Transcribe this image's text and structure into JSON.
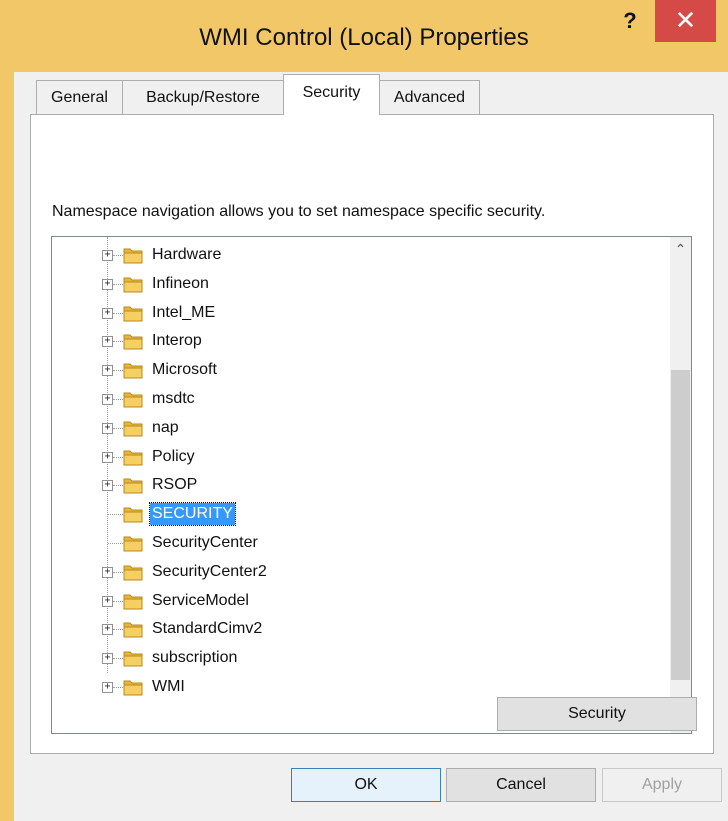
{
  "window": {
    "title": "WMI Control (Local) Properties",
    "help_label": "?",
    "close_label": "✕"
  },
  "tabs": [
    {
      "label": "General"
    },
    {
      "label": "Backup/Restore"
    },
    {
      "label": "Security",
      "active": true
    },
    {
      "label": "Advanced"
    }
  ],
  "security_tab": {
    "description": "Namespace navigation allows you to set namespace specific security.",
    "tree_items": [
      {
        "label": "Hardware",
        "expandable": true
      },
      {
        "label": "Infineon",
        "expandable": true
      },
      {
        "label": "Intel_ME",
        "expandable": true
      },
      {
        "label": "Interop",
        "expandable": true
      },
      {
        "label": "Microsoft",
        "expandable": true
      },
      {
        "label": "msdtc",
        "expandable": true
      },
      {
        "label": "nap",
        "expandable": true
      },
      {
        "label": "Policy",
        "expandable": true
      },
      {
        "label": "RSOP",
        "expandable": true
      },
      {
        "label": "SECURITY",
        "expandable": false,
        "selected": true
      },
      {
        "label": "SecurityCenter",
        "expandable": false
      },
      {
        "label": "SecurityCenter2",
        "expandable": true
      },
      {
        "label": "ServiceModel",
        "expandable": true
      },
      {
        "label": "StandardCimv2",
        "expandable": true
      },
      {
        "label": "subscription",
        "expandable": true
      },
      {
        "label": "WMI",
        "expandable": true
      }
    ],
    "security_button": "Security"
  },
  "footer": {
    "ok": "OK",
    "cancel": "Cancel",
    "apply": "Apply"
  },
  "colors": {
    "title_bar": "#f2c768",
    "close_button": "#d54a47",
    "selection": "#3399ff",
    "folder": "#e8b53a"
  },
  "icons": {
    "help": "question-mark-icon",
    "close": "close-icon",
    "expander": "plus-box-icon",
    "folder": "folder-icon",
    "scroll_up": "chevron-up-icon",
    "scroll_down": "chevron-down-icon"
  }
}
